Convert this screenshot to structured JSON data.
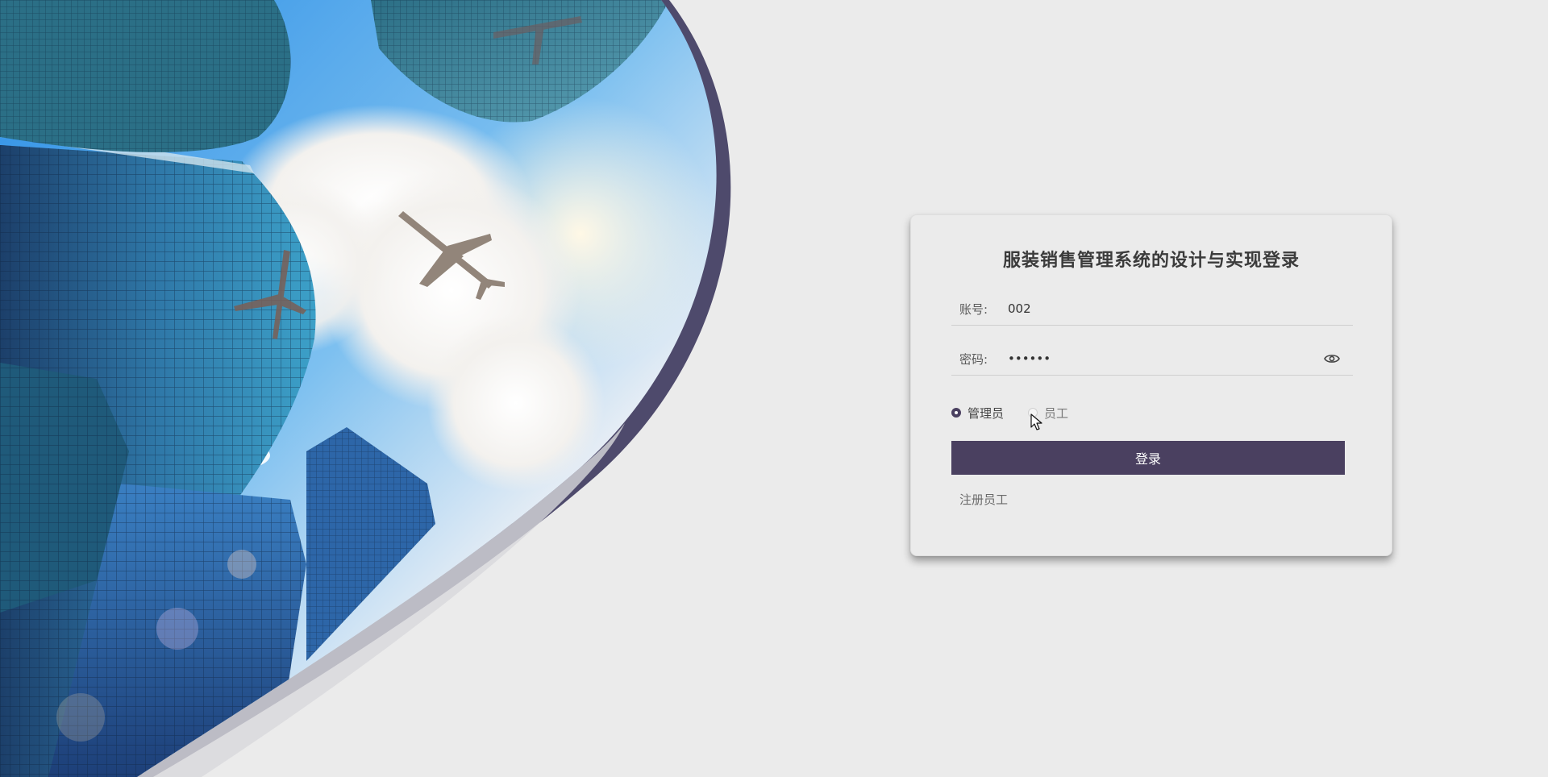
{
  "login": {
    "title": "服装销售管理系统的设计与实现登录",
    "account_label": "账号:",
    "account_value": "002",
    "password_label": "密码:",
    "password_value": "••••••",
    "roles": [
      {
        "label": "管理员",
        "checked": true
      },
      {
        "label": "员工",
        "checked": false
      }
    ],
    "login_button_label": "登录",
    "register_link_label": "注册员工"
  },
  "icons": {
    "password_toggle": "eye-icon",
    "mouse_pointer": "cursor-arrow-icon"
  },
  "colors": {
    "primary": "#4a4060",
    "background": "#ebebeb",
    "card_background": "#ebebeb",
    "title_text": "#3b3b3b",
    "border": "#cfcfcf"
  }
}
